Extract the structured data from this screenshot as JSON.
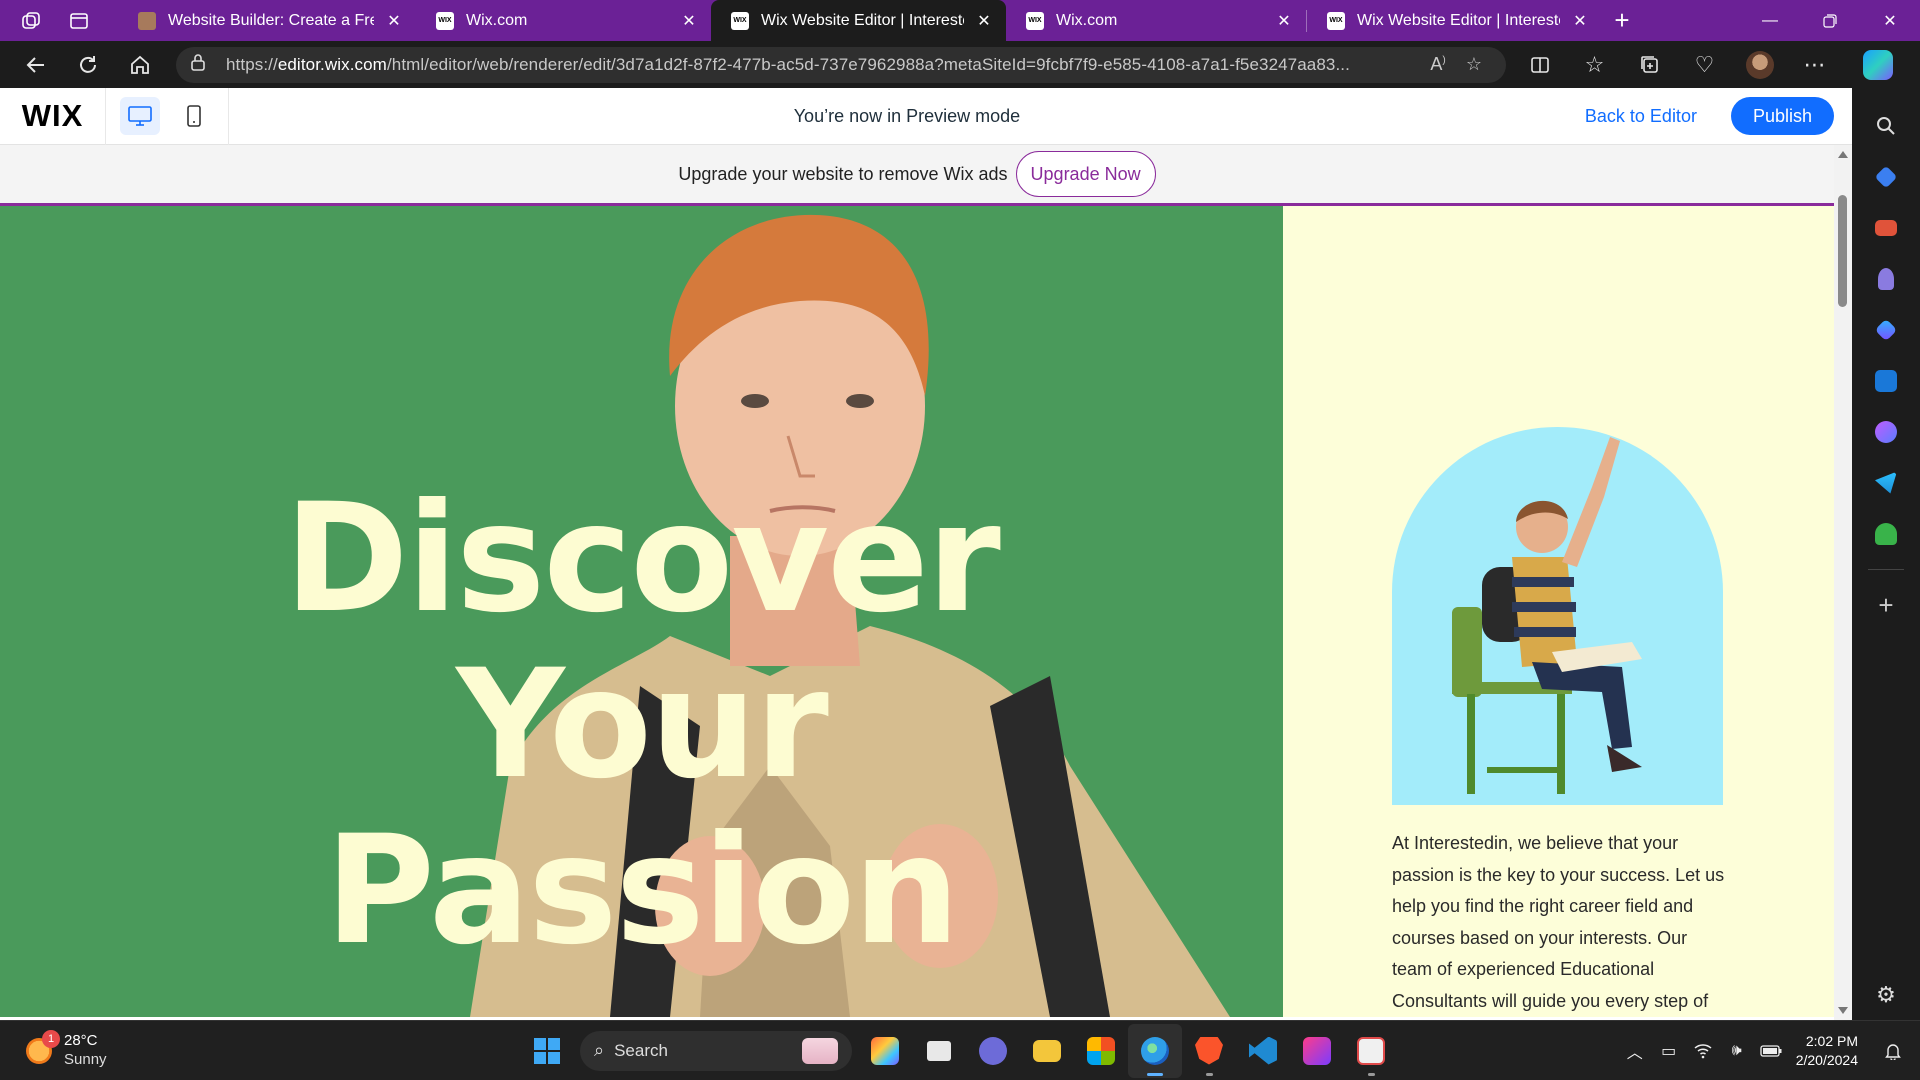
{
  "browser": {
    "tabs": [
      {
        "title": "Website Builder: Create a Free W",
        "favicon": "site-favicon",
        "active": false
      },
      {
        "title": "Wix.com",
        "favicon": "wix-favicon",
        "active": false
      },
      {
        "title": "Wix Website Editor | Interestedin",
        "favicon": "wix-favicon",
        "active": true
      },
      {
        "title": "Wix.com",
        "favicon": "wix-favicon",
        "active": false
      },
      {
        "title": "Wix Website Editor | Interestedin",
        "favicon": "wix-favicon",
        "active": false
      }
    ],
    "url_prefix": "https://",
    "url_host": "editor.wix.com",
    "url_rest": "/html/editor/web/renderer/edit/3d7a1d2f-87f2-477b-ac5d-737e7962988a?metaSiteId=9fcbf7f9-e585-4108-a7a1-f5e3247aa83..."
  },
  "editor": {
    "logo": "WIX",
    "preview_message": "You’re now in Preview mode",
    "back_label": "Back to Editor",
    "publish_label": "Publish"
  },
  "ad": {
    "text": "Upgrade your website to remove Wix ads",
    "button": "Upgrade Now"
  },
  "hero": {
    "title_line1": "Discover",
    "title_line2": "Your",
    "title_line3": "Passion",
    "body": "At Interestedin, we believe that your passion is the key to your success. Let us help you find the right career field and courses based on your interests. Our team of experienced Educational Consultants will guide you every step of"
  },
  "colors": {
    "hero_green": "#4a9a5b",
    "hero_cream": "#fdfed9",
    "title_cream": "#fdfcd2",
    "arch_blue": "#a3ecfa",
    "wix_blue": "#116dff",
    "ad_purple": "#8a2b9b"
  },
  "taskbar": {
    "badge": "1",
    "temp": "28°C",
    "condition": "Sunny",
    "search_label": "Search",
    "time": "2:02 PM",
    "date": "2/20/2024"
  }
}
